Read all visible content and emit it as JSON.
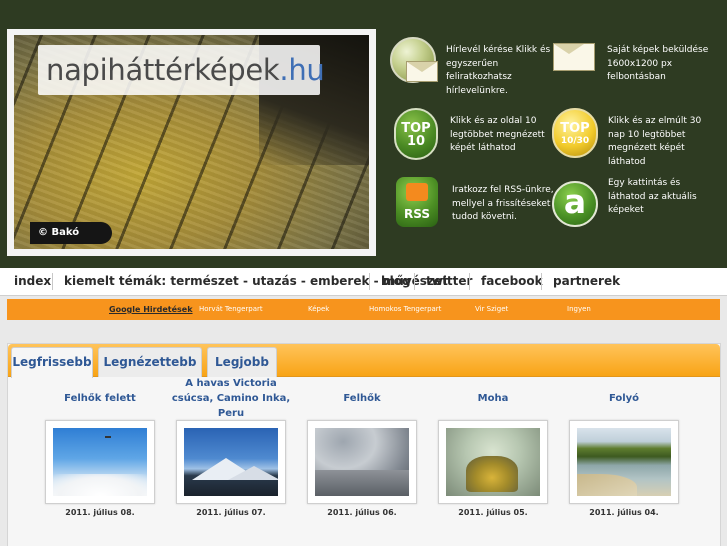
{
  "site": {
    "logo_name": "napiháttérképek",
    "logo_tld": ".hu",
    "credit": "© Bakó"
  },
  "features": [
    {
      "icon": "globe-envelope-icon",
      "text": "Hírlevél kérése Klikk és egyszerűen feliratkozhatsz hírlevelünkre."
    },
    {
      "icon": "envelope-icon",
      "text": "Saját képek beküldése 1600x1200 px felbontásban"
    },
    {
      "icon": "top10-icon",
      "icon_text": "TOP 10",
      "text": "Klikk és az oldal 10 legtöbbet megnézett képét láthatod"
    },
    {
      "icon": "top10-30-icon",
      "icon_text_1": "TOP",
      "icon_text_2": "10/30",
      "text": "Klikk és az elmúlt 30 nap 10 legtöbbet megnézett képét láthatod"
    },
    {
      "icon": "rss-icon",
      "icon_text": "RSS",
      "text": "Iratkozz fel RSS-ünkre, mellyel a frissítéseket tudod követni."
    },
    {
      "icon": "a-icon",
      "icon_text": "a",
      "text": "Egy kattintás és láthatod az aktuális képeket"
    }
  ],
  "nav": [
    "index",
    "kiemelt témák: természet - utazás - emberek - művészet",
    "blog",
    "twitter",
    "facebook",
    "partnerek"
  ],
  "ads": {
    "label": "Google Hirdetések",
    "links": [
      "Horvát Tengerpart",
      "Képek",
      "Homokos Tengerpart",
      "Vir Sziget",
      "Ingyen"
    ]
  },
  "tabs": [
    "Legfrissebb",
    "Legnézettebb",
    "Legjobb"
  ],
  "images": [
    {
      "title": "Felhők felett",
      "date": "2011. július 08."
    },
    {
      "title": "A havas Victoria csúcsa, Camino Inka, Peru",
      "date": "2011. július 07."
    },
    {
      "title": "Felhők",
      "date": "2011. július 06."
    },
    {
      "title": "Moha",
      "date": "2011. július 05."
    },
    {
      "title": "Folyó",
      "date": "2011. július 04."
    }
  ]
}
